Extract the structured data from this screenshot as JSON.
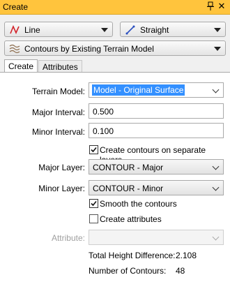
{
  "window": {
    "title": "Create",
    "pin_glyph": "pin-icon",
    "close_glyph": "✕"
  },
  "toolbar": {
    "line_type": {
      "label": "Line",
      "icon": "line-zigzag-icon"
    },
    "segment_type": {
      "label": "Straight",
      "icon": "straight-line-icon"
    },
    "create_mode": {
      "label": "Contours by Existing Terrain Model",
      "icon": "contours-icon"
    }
  },
  "tabs": [
    {
      "label": "Create",
      "active": true
    },
    {
      "label": "Attributes",
      "active": false
    }
  ],
  "form": {
    "terrain_model": {
      "label": "Terrain Model:",
      "value": "Model - Original Surface"
    },
    "major_interval": {
      "label": "Major Interval:",
      "value": "0.500"
    },
    "minor_interval": {
      "label": "Minor Interval:",
      "value": "0.100"
    },
    "separate_layers": {
      "label": "Create contours on separate layers",
      "checked": true
    },
    "major_layer": {
      "label": "Major Layer:",
      "value": "CONTOUR - Major"
    },
    "minor_layer": {
      "label": "Minor Layer:",
      "value": "CONTOUR - Minor"
    },
    "smooth": {
      "label": "Smooth the contours",
      "checked": true
    },
    "create_attributes": {
      "label": "Create attributes",
      "checked": false
    },
    "attribute": {
      "label": "Attribute:",
      "value": ""
    },
    "total_height_difference": {
      "label": "Total Height Difference:",
      "value": "2.108"
    },
    "number_of_contours": {
      "label": "Number of Contours:",
      "value": "48"
    }
  }
}
